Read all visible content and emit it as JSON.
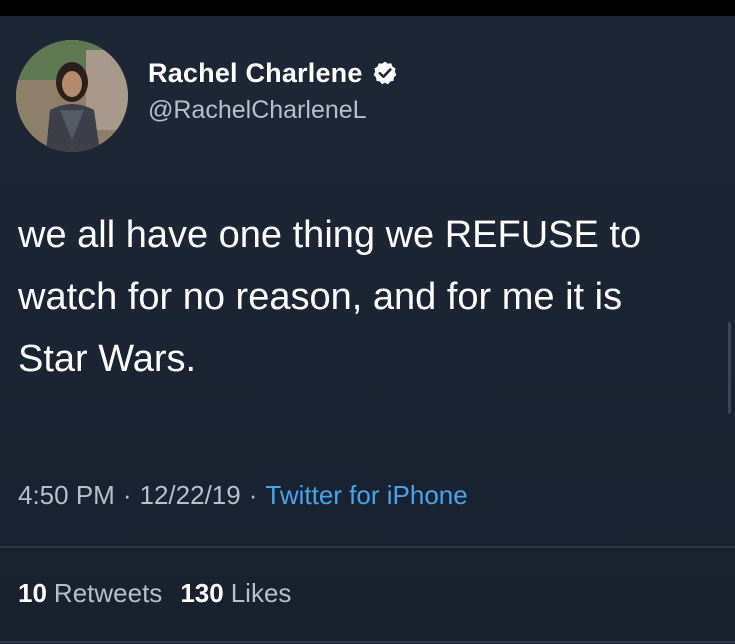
{
  "author": {
    "name": "Rachel Charlene",
    "handle": "@RachelCharleneL",
    "verified": true
  },
  "tweet": {
    "text": "we all have one thing we REFUSE to\nwatch for no reason, and for me it is\nStar Wars."
  },
  "meta": {
    "time": "4:50 PM",
    "separator": "·",
    "date": "12/22/19",
    "source": "Twitter for iPhone"
  },
  "stats": {
    "retweets_count": "10",
    "retweets_label": "Retweets",
    "likes_count": "130",
    "likes_label": "Likes"
  },
  "colors": {
    "background": "#1a2331",
    "link": "#4aa3e8",
    "muted_text": "#b6bfca",
    "verified_badge": "#ffffff"
  },
  "icons": {
    "verified": "verified-badge-icon"
  }
}
